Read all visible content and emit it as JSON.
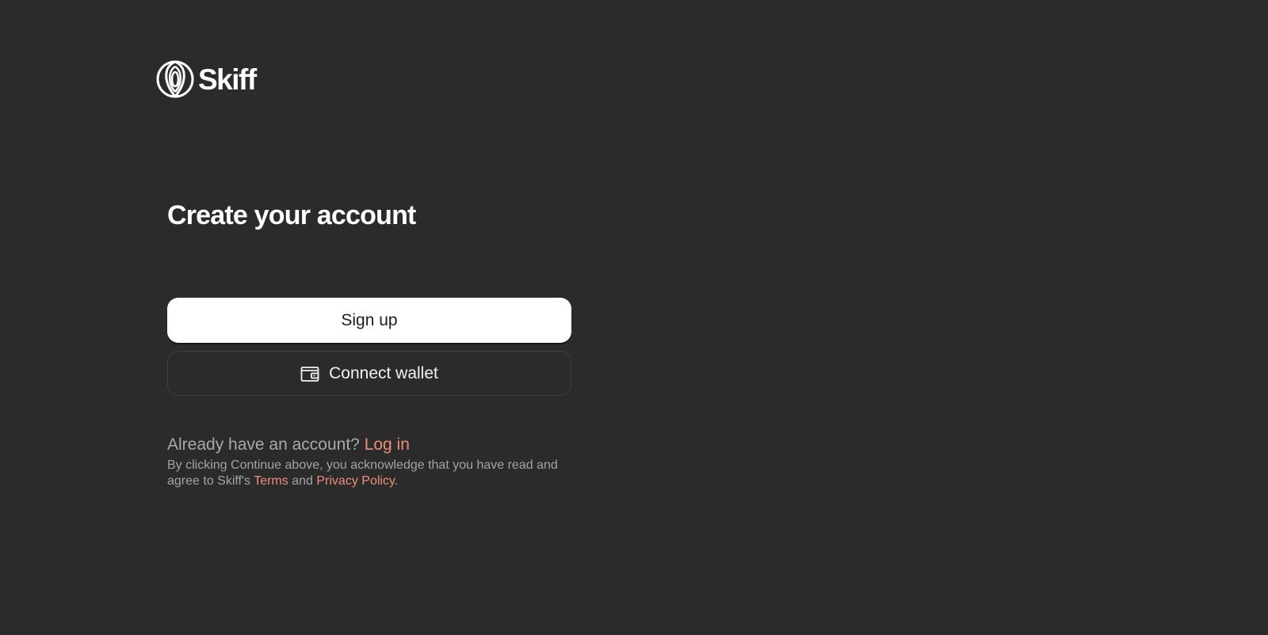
{
  "brand": {
    "name": "Skiff",
    "logo_icon": "skiff-swirl-logo-icon"
  },
  "main": {
    "title": "Create your account",
    "signup_label": "Sign up",
    "connect_wallet_label": "Connect wallet",
    "connect_wallet_icon": "wallet-icon",
    "login_prompt": "Already have an account?",
    "login_link": "Log in",
    "legal_prefix": "By clicking Continue above, you acknowledge that you have read and agree to Skiff's",
    "terms_link": "Terms",
    "legal_and": "and",
    "privacy_link": "Privacy Policy",
    "legal_suffix": "."
  },
  "colors": {
    "background": "#2b2b2b",
    "primary_button": "#ffffff",
    "link_accent": "#ef8f7a",
    "muted_text": "#a9a9a9"
  }
}
